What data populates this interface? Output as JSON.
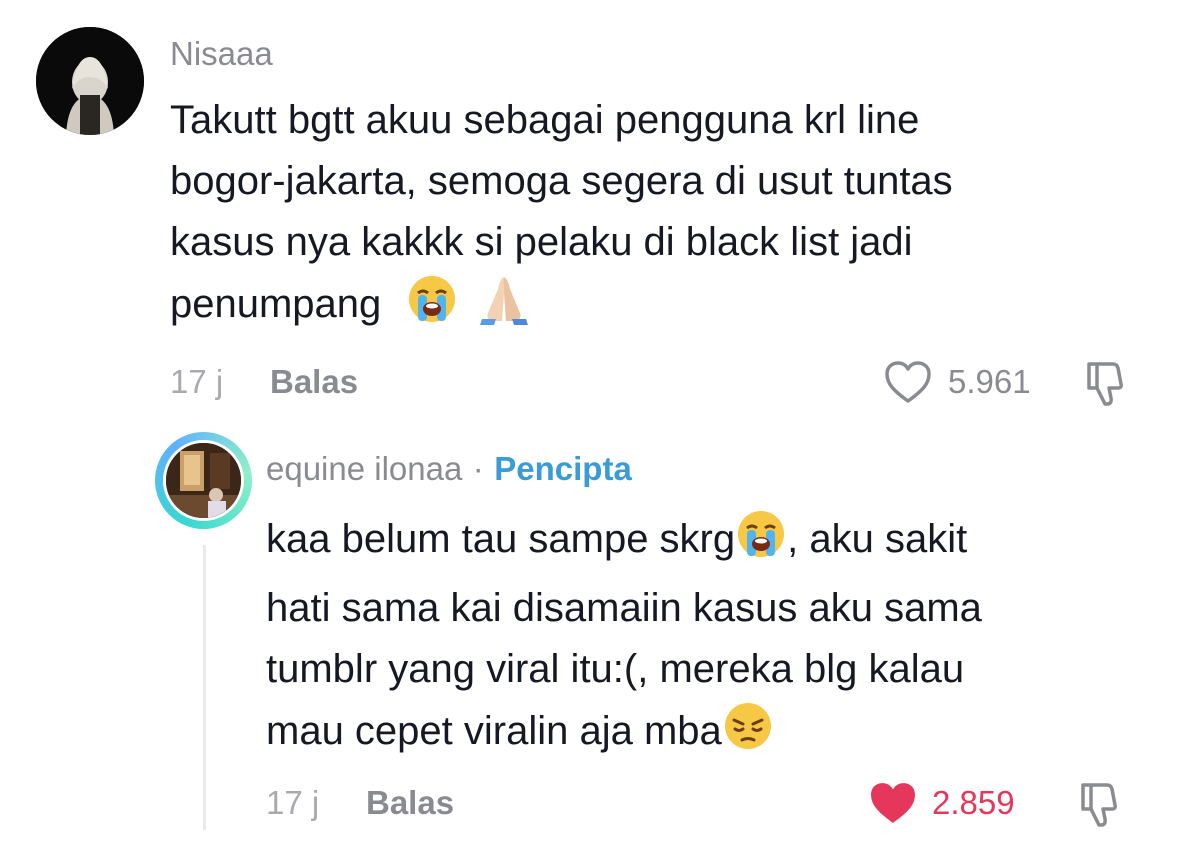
{
  "comment": {
    "username": "Nisaaa",
    "text_line_1": "Takutt bgtt akuu sebagai pengguna krl line",
    "text_line_2": "bogor-jakarta, semoga segera di usut tuntas",
    "text_line_3": "kasus nya kakkk si pelaku di black list jadi",
    "text_line_4": "penumpang",
    "emojis_line_4": [
      "crying-face",
      "folded-hands"
    ],
    "time": "17 j",
    "reply_label": "Balas",
    "like_count": "5.961",
    "liked": false
  },
  "reply": {
    "username": "equine ilonaa",
    "separator": "·",
    "creator_badge": "Pencipta",
    "text_line_1a": "kaa belum tau sampe skrg",
    "text_line_1b": ", aku sakit",
    "text_line_2": "hati sama kai disamaiin kasus aku sama",
    "text_line_3": "tumblr yang viral itu:(, mereka blg kalau",
    "text_line_4": "mau cepet viralin aja mba",
    "emojis": [
      "crying-face",
      "pensive-face"
    ],
    "time": "17 j",
    "reply_label": "Balas",
    "like_count": "2.859",
    "liked": true
  },
  "colors": {
    "username_gray": "#8a8b91",
    "text_dark": "#161823",
    "like_red": "#e5375b",
    "creator_blue": "#3a9bd6"
  }
}
